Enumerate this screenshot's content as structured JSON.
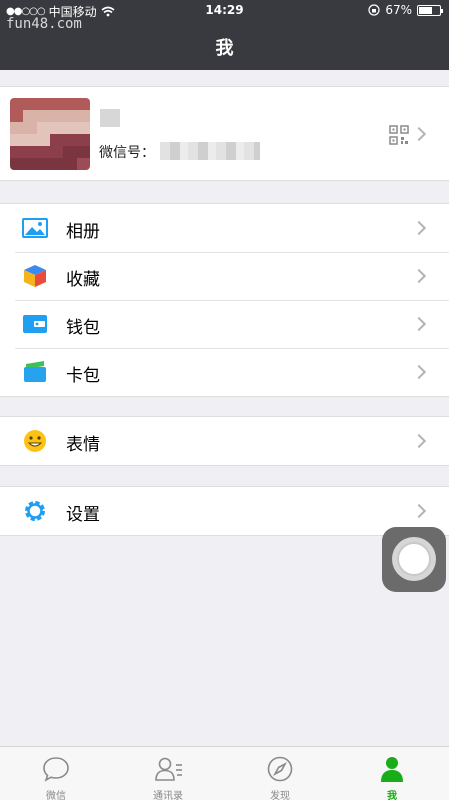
{
  "status_bar": {
    "carrier": "中国移动",
    "time": "14:29",
    "battery": "67%",
    "battery_level": 0.67
  },
  "watermark": "fun48.com",
  "nav": {
    "title": "我"
  },
  "profile": {
    "wechat_id_label": "微信号："
  },
  "groups": [
    [
      {
        "label": "相册",
        "icon": "album-icon"
      },
      {
        "label": "收藏",
        "icon": "favorites-icon"
      },
      {
        "label": "钱包",
        "icon": "wallet-icon"
      },
      {
        "label": "卡包",
        "icon": "card-holder-icon"
      }
    ],
    [
      {
        "label": "表情",
        "icon": "sticker-icon"
      }
    ],
    [
      {
        "label": "设置",
        "icon": "settings-icon"
      }
    ]
  ],
  "tabs": [
    {
      "label": "微信",
      "icon": "chat-icon"
    },
    {
      "label": "通讯录",
      "icon": "contacts-icon"
    },
    {
      "label": "发现",
      "icon": "discover-icon"
    },
    {
      "label": "我",
      "icon": "me-icon",
      "active": true
    }
  ],
  "colors": {
    "nav_bg": "#393a3f",
    "accent_green": "#1aad19",
    "page_bg": "#efeff4"
  }
}
